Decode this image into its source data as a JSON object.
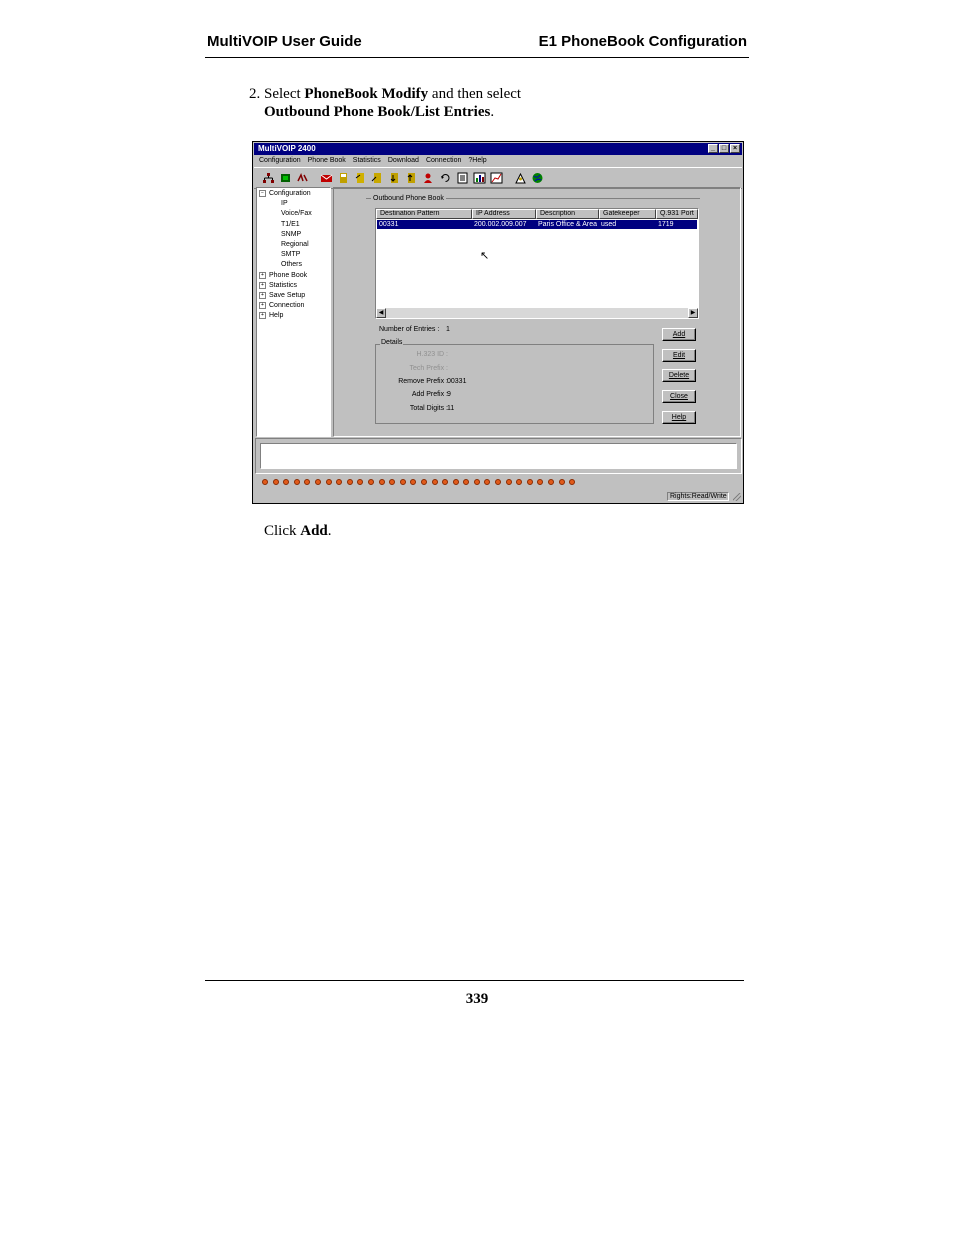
{
  "header": {
    "left": "MultiVOIP User Guide",
    "right": "E1 PhoneBook Configuration"
  },
  "step": {
    "prefix": "2. Select ",
    "bold1": "PhoneBook Modify",
    "middle": " and then select",
    "bold2": "Outbound Phone Book/List Entries",
    "suffix": "."
  },
  "click": {
    "prefix": "Click ",
    "bold": "Add",
    "suffix": "."
  },
  "page_number": "339",
  "app": {
    "title": "MultiVOIP 2400",
    "menu": [
      "Configuration",
      "Phone Book",
      "Statistics",
      "Download",
      "Connection",
      "?Help"
    ],
    "toolbar_icons": [
      "network-icon",
      "chip-icon",
      "voice-icon",
      "mail-icon",
      "book-icon",
      "book-icon",
      "book-icon",
      "book-icon",
      "book-icon",
      "cycle-icon",
      "list-icon",
      "chart-icon",
      "graph-icon",
      "user-icon",
      "globe-icon"
    ],
    "tree": {
      "root": "Configuration",
      "children": [
        "IP",
        "Voice/Fax",
        "T1/E1",
        "SNMP",
        "Regional",
        "SMTP",
        "Others"
      ],
      "top_items": [
        "Phone Book",
        "Statistics",
        "Save Setup",
        "Connection",
        "Help"
      ]
    },
    "group_title": "Outbound Phone Book",
    "columns": [
      "Destination Pattern",
      "IP Address",
      "Description",
      "Gatekeeper",
      "Q.931 Port"
    ],
    "rows": [
      {
        "dest": "00331",
        "ip": "200.002.009.007",
        "desc": "Paris Office & Area",
        "gk": "used",
        "port": "1719"
      }
    ],
    "num_entries_label": "Number of Entries :",
    "num_entries_value": "1",
    "details_title": "Details",
    "details": {
      "h323_label": "H.323 ID :",
      "tech_label": "Tech Prefix :",
      "remove_label": "Remove Prefix :",
      "remove_value": "00331",
      "add_label": "Add Prefix :",
      "add_value": "9",
      "total_label": "Total Digits :",
      "total_value": "11"
    },
    "buttons": {
      "add": "Add",
      "edit": "Edit",
      "delete": "Delete",
      "close": "Close",
      "help": "Help"
    },
    "led_count": 30,
    "led_color": "#e05a1a",
    "rights": "Rights:Read/Write"
  }
}
